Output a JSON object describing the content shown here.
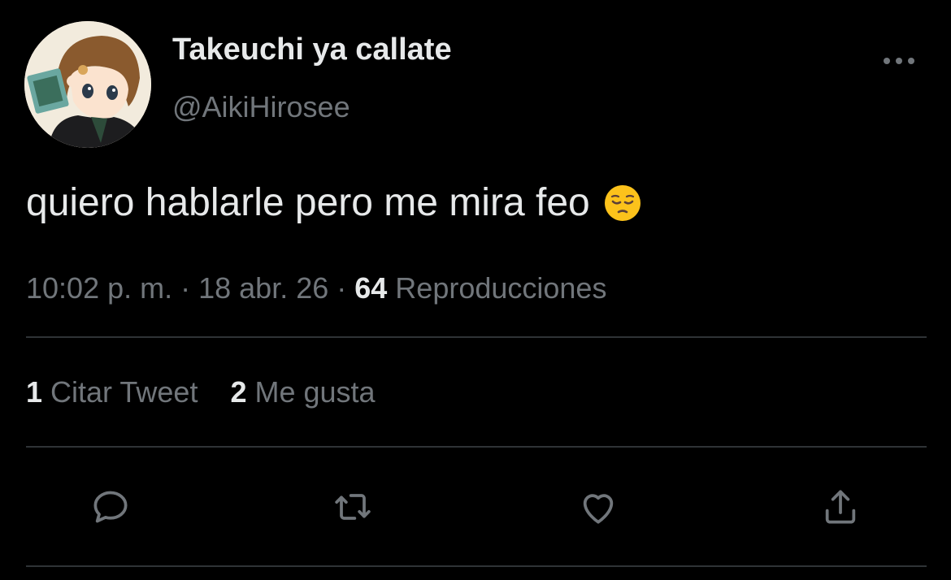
{
  "tweet": {
    "author": {
      "display_name": "Takeuchi ya callate",
      "handle": "@AikiHirosee"
    },
    "text": "quiero hablarle pero me mira feo",
    "emoji": "pensive-face",
    "meta": {
      "time": "10:02 p. m.",
      "dot1": " · ",
      "date": "18 abr. 26",
      "dot2": " · ",
      "views_count": "64",
      "views_label": " Reproducciones"
    },
    "stats": {
      "quotes_count": "1",
      "quotes_label": " Citar Tweet",
      "likes_count": "2",
      "likes_label": " Me gusta"
    }
  },
  "actions": [
    "reply-icon",
    "retweet-icon",
    "like-icon",
    "share-icon"
  ],
  "colors": {
    "background": "#000000",
    "primary_text": "#e7e9ea",
    "secondary_text": "#71767b",
    "divider": "#2f3336"
  }
}
